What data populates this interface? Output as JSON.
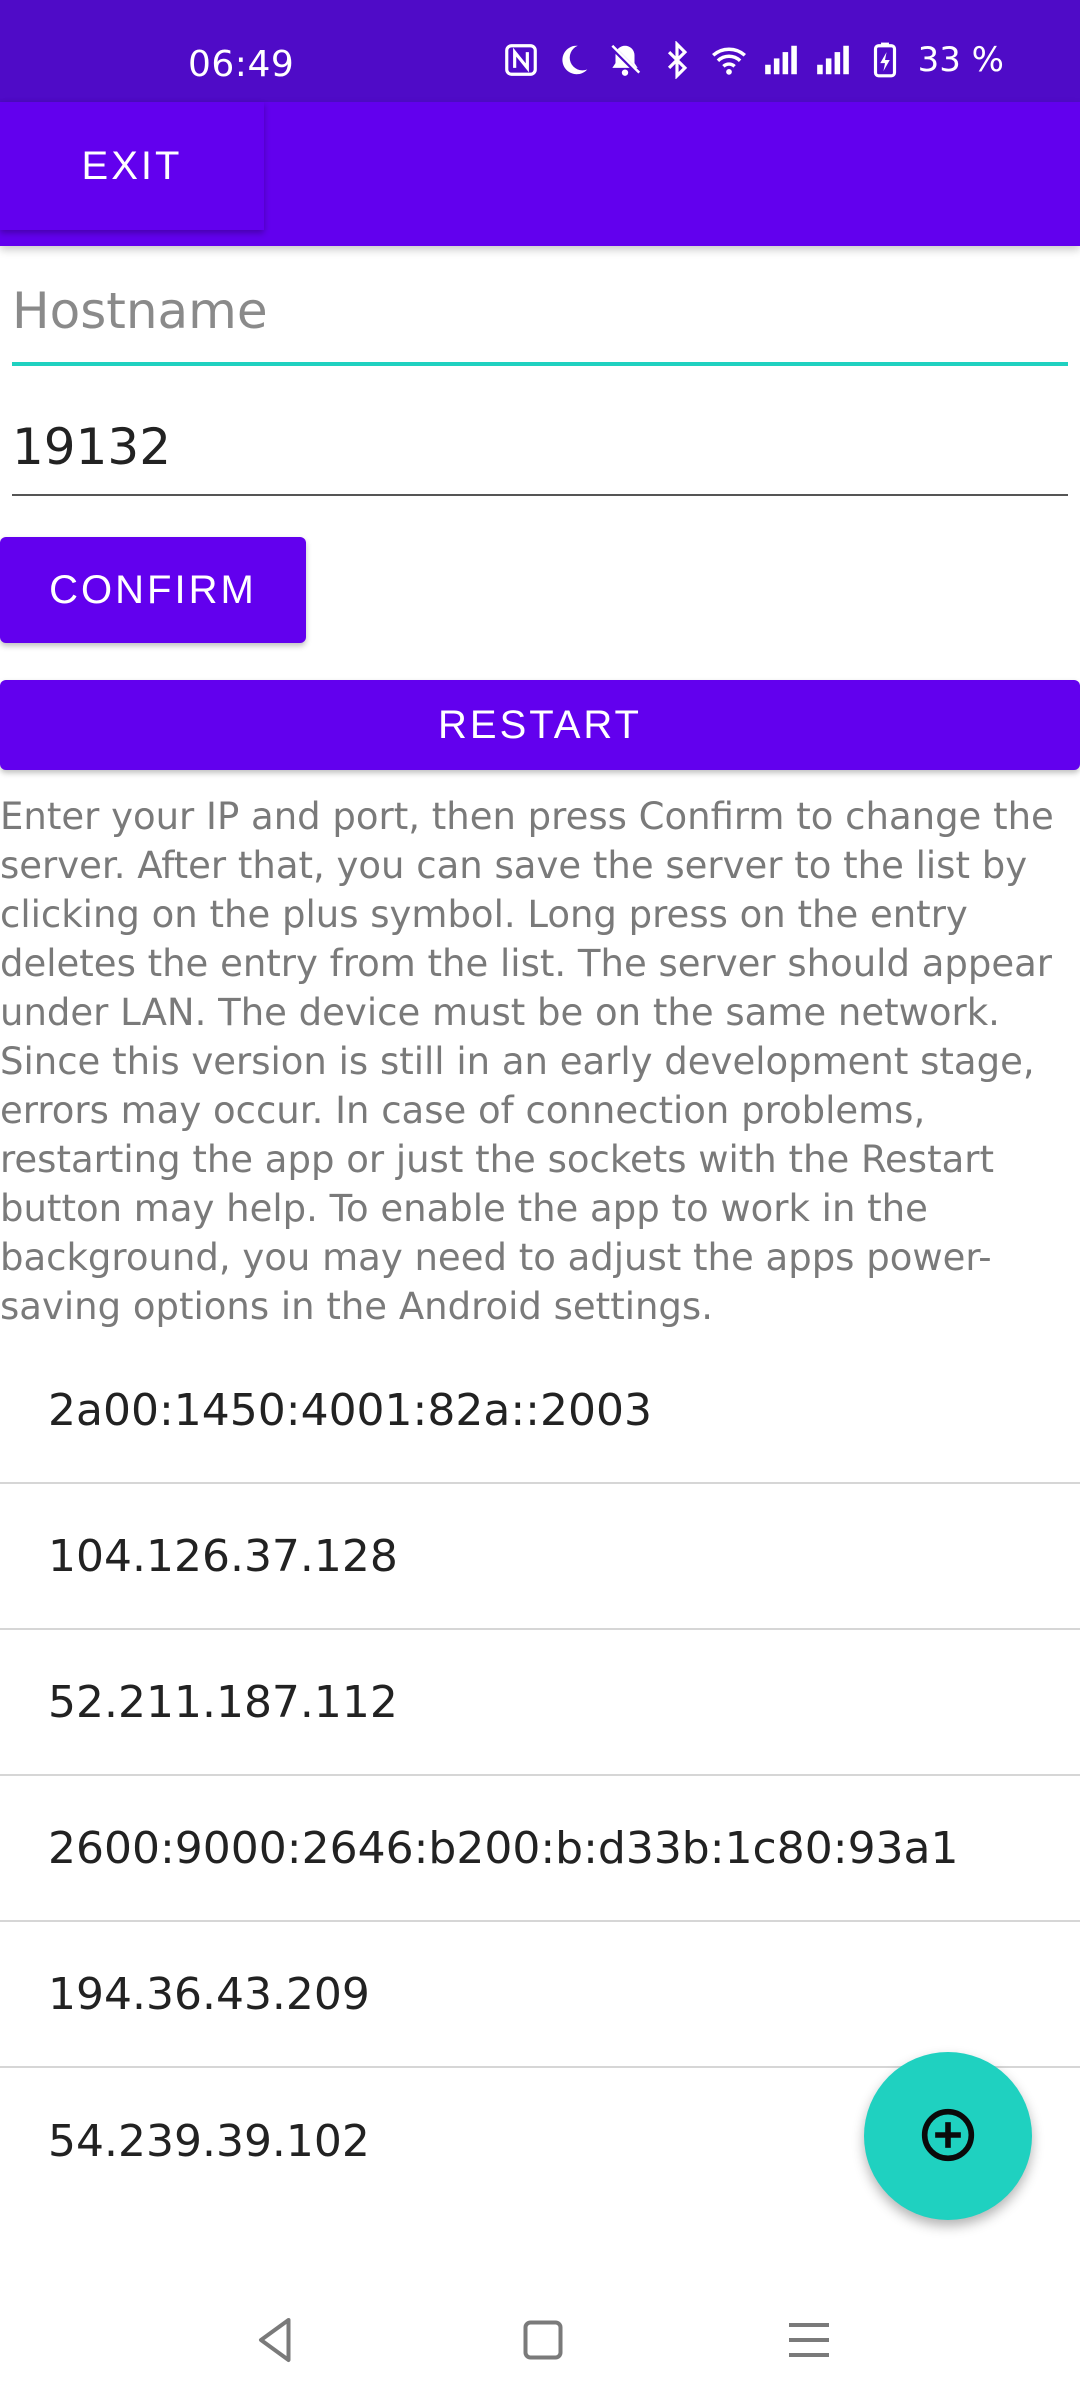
{
  "status_bar": {
    "time": "06:49",
    "battery": "33 %",
    "icons": [
      "nfc-icon",
      "moon-icon",
      "bell-off-icon",
      "bluetooth-icon",
      "wifi-icon",
      "signal-icon",
      "signal-icon",
      "battery-charging-icon"
    ]
  },
  "app_bar": {
    "exit_label": "EXIT"
  },
  "form": {
    "hostname_placeholder": "Hostname",
    "hostname_value": "",
    "port_value": "19132",
    "confirm_label": "CONFIRM",
    "restart_label": "RESTART"
  },
  "description": "Enter your IP and port, then press Confirm to change the server. After that, you can save the server to the list by clicking on the plus symbol. Long press on the entry deletes the entry from the list. The server should appear under LAN. The device must be on the same network. Since this version is still in an early development stage, errors may occur. In case of connection problems, restarting the app or just the sockets with the Restart button may help. To enable the app to work in the background, you may need to adjust the apps power-saving options in the Android settings.",
  "servers": [
    "2a00:1450:4001:82a::2003",
    "104.126.37.128",
    "52.211.187.112",
    "2600:9000:2646:b200:b:d33b:1c80:93a1",
    "194.36.43.209",
    "54.239.39.102"
  ],
  "fab": {
    "icon": "add-circle-icon"
  },
  "nav_bar": {
    "icons": [
      "back-icon",
      "home-icon",
      "menu-icon"
    ]
  },
  "colors": {
    "status_bar": "#4f0bc7",
    "primary": "#6200ee",
    "accent": "#1fd1c0"
  }
}
